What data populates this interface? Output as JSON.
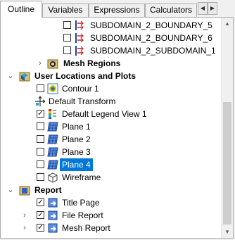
{
  "tabs": [
    {
      "label": "Outline",
      "active": true
    },
    {
      "label": "Variables",
      "active": false
    },
    {
      "label": "Expressions",
      "active": false
    },
    {
      "label": "Calculators",
      "active": false
    }
  ],
  "tree": {
    "subdomain_items": [
      "SUBDOMAIN_2_BOUNDARY_5",
      "SUBDOMAIN_2_BOUNDARY_6",
      "SUBDOMAIN_2_SUBDOMAIN_1"
    ],
    "mesh_regions": "Mesh Regions",
    "user_locations": "User Locations and Plots",
    "contour": "Contour 1",
    "default_transform": "Default Transform",
    "legend_view": "Default Legend View 1",
    "planes": [
      "Plane 1",
      "Plane 2",
      "Plane 3",
      "Plane 4"
    ],
    "wireframe": "Wireframe",
    "report": "Report",
    "title_page": "Title Page",
    "file_report": "File Report",
    "mesh_report": "Mesh Report"
  },
  "colors": {
    "selection": "#0078d7",
    "accent_cyan": "#00a0c8"
  }
}
